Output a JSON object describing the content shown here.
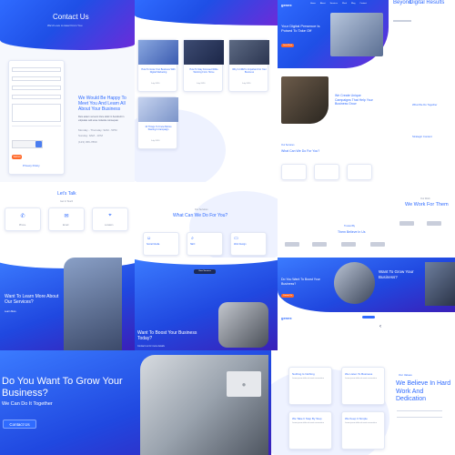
{
  "colors": {
    "primary": "#2f6bff",
    "accent": "#6c2bd9",
    "orange": "#ff6a2b",
    "dark": "#1d2a55"
  },
  "contact": {
    "title": "Contact Us",
    "subtitle": "We'd Love to Hear From You",
    "heading": "We Would Be Happy To Meet You And Learn All About Your Business",
    "body": "Duis autem vel eum iriure dolor in hendrerit in vulputate velit esse molestie consequat.",
    "hours": "Monday - Thursday: 9AM - 5PM",
    "hours2": "Sunday: 9AM - 1PM",
    "phone": "(123) 456-7890",
    "submit": "Submit",
    "recaptcha": "I'm not a robot",
    "link": "Privacy Policy"
  },
  "blog": {
    "cards": [
      {
        "title": "How To Grow Your Business With Digital Marketing",
        "meta": "July 2020"
      },
      {
        "title": "How To Stay Focused While Working From Home",
        "meta": "July 2020"
      },
      {
        "title": "Why A CRM Is Important For Your Business",
        "meta": "July 2020"
      },
      {
        "title": "10 Things To Know Before Starting A Campaign",
        "meta": "July 2020"
      }
    ]
  },
  "hero_top": {
    "logo": "genex",
    "nav": [
      "Home",
      "About",
      "Services",
      "Work",
      "Blog",
      "Contact"
    ],
    "headline": "Your Digital Presence Is Poised To Take Off",
    "button": "Learn More",
    "corner1": "Beyond",
    "corner2": "Digital Results"
  },
  "about": {
    "heading": "We Create Unique Campaigns That Help Your Business Grow",
    "services_label": "Our Services",
    "services_heading": "What Can We Do For You?",
    "side1": "What We Do Together",
    "side2": "Strategic Content"
  },
  "talk": {
    "title": "Let's Talk",
    "subtitle": "Get In Touch",
    "items": [
      "Phone",
      "Email",
      "Location"
    ]
  },
  "services": {
    "label": "Our Services",
    "heading": "What Can We Do For You?",
    "items": [
      "Social Media",
      "SEO",
      "Web Design"
    ],
    "button": "View Services"
  },
  "works": {
    "label": "Our Work",
    "heading": "We Work For Them",
    "clients_label": "Trusted By",
    "clients_title": "Them Believe In Us"
  },
  "cta_left": {
    "heading": "Want To Learn More About Our Services?",
    "link": "Learn More"
  },
  "cta_mid": {
    "heading": "Want To Boost Your Business Today?",
    "sub": "Contact us for more details"
  },
  "cta_right": {
    "heading": "Do You Want To Boost Your Business?",
    "button": "Contact Us",
    "heading2": "Want To Grow Your Business?"
  },
  "bottom": {
    "heading": "Do You Want To Grow Your Business?",
    "sub": "We Can Do It Together",
    "button": "Contact Us"
  },
  "values": {
    "label": "Our Values",
    "heading": "We Believe In Hard Work And Dedication",
    "cards": [
      {
        "title": "Nothing Is Nothing",
        "text": "Lorem ipsum dolor sit amet consectetur"
      },
      {
        "title": "We Listen To Business",
        "text": "Lorem ipsum dolor sit amet consectetur"
      },
      {
        "title": "We Take It Step By Step",
        "text": "Lorem ipsum dolor sit amet consectetur"
      },
      {
        "title": "We Keep It Simple",
        "text": "Lorem ipsum dolor sit amet consectetur"
      }
    ],
    "logo": "genex"
  }
}
